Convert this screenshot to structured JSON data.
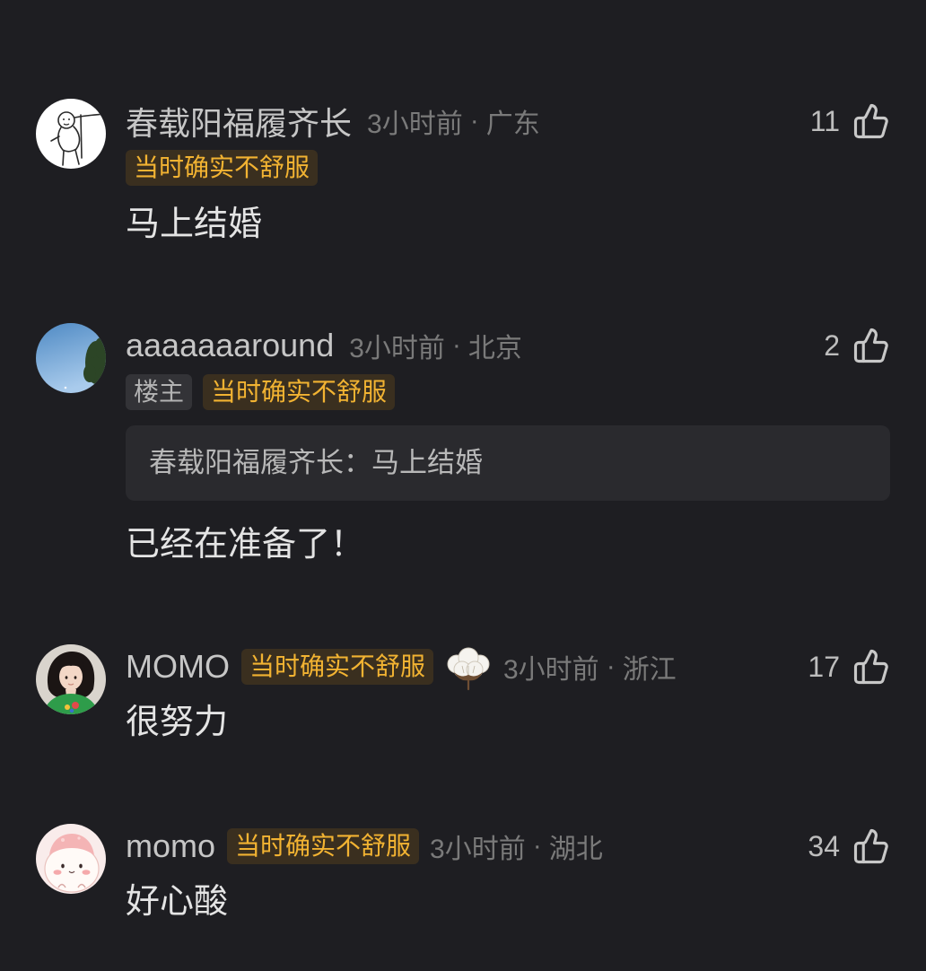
{
  "colors": {
    "background": "#1e1e22",
    "username": "#c6c6c6",
    "meta": "#7a7a7a",
    "text": "#e4e4e4",
    "badge_bg": "#3a2f1f",
    "badge_text": "#f2b332",
    "op_badge_bg": "#333337",
    "op_badge_text": "#b3b3b3",
    "quote_bg": "#2a2a2e",
    "quote_text": "#b8b8b8",
    "like_count": "#bdbdbd",
    "like_icon": "#c8c8c8"
  },
  "icons": {
    "like": "thumbs-up-icon"
  },
  "meta_separator": "·",
  "comments": [
    {
      "username": "春载阳福履齐长",
      "time": "3小时前",
      "location": "广东",
      "badge": "当时确实不舒服",
      "likes": 11,
      "text": "马上结婚"
    },
    {
      "username": "aaaaaaaround",
      "time": "3小时前",
      "location": "北京",
      "op_badge": "楼主",
      "badge": "当时确实不舒服",
      "quote": "春载阳福履齐长：马上结婚",
      "likes": 2,
      "text": "已经在准备了！"
    },
    {
      "username": "MOMO",
      "badge": "当时确实不舒服",
      "badge_icon": "cotton-icon",
      "time": "3小时前",
      "location": "浙江",
      "likes": 17,
      "text": "很努力"
    },
    {
      "username": "momo",
      "badge": "当时确实不舒服",
      "time": "3小时前",
      "location": "湖北",
      "likes": 34,
      "text": "好心酸"
    }
  ]
}
